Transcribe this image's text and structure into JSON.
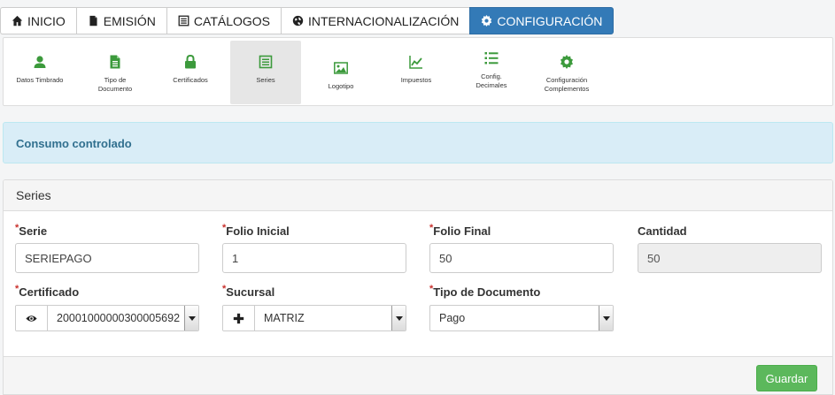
{
  "topnav": {
    "tabs": [
      {
        "label": "INICIO",
        "icon": "home-icon"
      },
      {
        "label": "EMISIÓN",
        "icon": "file-icon"
      },
      {
        "label": "CATÁLOGOS",
        "icon": "list-icon"
      },
      {
        "label": "INTERNACIONALIZACIÓN",
        "icon": "globe-icon"
      },
      {
        "label": "CONFIGURACIÓN",
        "icon": "gear-icon",
        "active": true
      }
    ]
  },
  "subnav": {
    "items": [
      {
        "label": "Datos Timbrado",
        "icon": "user-icon"
      },
      {
        "label": "Tipo de\nDocumento",
        "icon": "document-icon"
      },
      {
        "label": "Certificados",
        "icon": "lock-icon"
      },
      {
        "label": "Series",
        "icon": "list-icon",
        "active": true
      },
      {
        "label": "Logotipo",
        "icon": "image-icon"
      },
      {
        "label": "Impuestos",
        "icon": "chart-line-icon"
      },
      {
        "label": "Config.\nDecimales",
        "icon": "list-ordered-icon"
      },
      {
        "label": "Configuración\nComplementos",
        "icon": "gear-icon"
      }
    ]
  },
  "alert": {
    "text": "Consumo controlado"
  },
  "panel": {
    "title": "Series",
    "fields": {
      "serie": {
        "label": "Serie",
        "value": "SERIEPAGO",
        "required": true
      },
      "folio_inicial": {
        "label": "Folio Inicial",
        "value": "1",
        "required": true
      },
      "folio_final": {
        "label": "Folio Final",
        "value": "50",
        "required": true
      },
      "cantidad": {
        "label": "Cantidad",
        "value": "50",
        "required": false
      },
      "certificado": {
        "label": "Certificado",
        "value": "20001000000300005692",
        "required": true
      },
      "sucursal": {
        "label": "Sucursal",
        "value": "MATRIZ",
        "required": true
      },
      "tipo_documento": {
        "label": "Tipo de Documento",
        "value": "Pago",
        "required": true
      }
    },
    "save_label": "Guardar"
  },
  "colors": {
    "primary": "#337ab7",
    "success": "#5cb85c",
    "icon_green": "#3c9a3c",
    "alert_bg": "#d9edf7",
    "alert_text": "#31708f",
    "required": "#c9302c"
  }
}
